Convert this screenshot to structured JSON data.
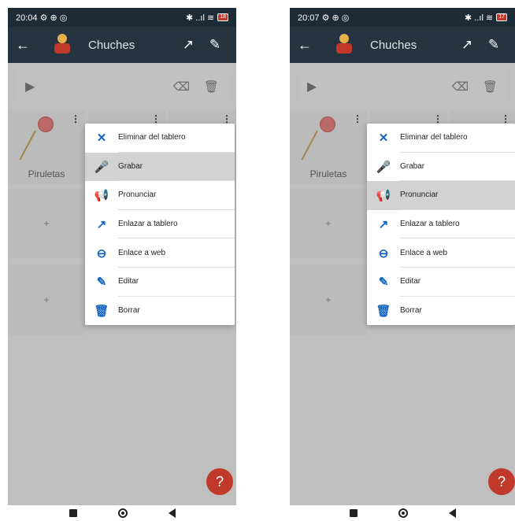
{
  "left": {
    "status": {
      "time": "20:04",
      "icons": "⚙ ⊕ ◎",
      "right_icons": "✱ ..ıl ≋",
      "battery": "18"
    },
    "appbar": {
      "title": "Chuches",
      "back": "←",
      "open": "↗",
      "edit": "✎"
    },
    "tiles": [
      {
        "label": "Piruletas"
      },
      {
        "plus": "+"
      },
      {
        "plus": "+"
      }
    ],
    "menu": {
      "selected": 1,
      "items": [
        {
          "label": "Eliminar del tablero",
          "icon": "✕"
        },
        {
          "label": "Grabar",
          "icon": "🎤"
        },
        {
          "label": "Pronunciar",
          "icon": "📢"
        },
        {
          "label": "Enlazar a tablero",
          "icon": "↗"
        },
        {
          "label": "Enlace a web",
          "icon": "⊖"
        },
        {
          "label": "Editar",
          "icon": "✎"
        },
        {
          "label": "Borrar",
          "icon": "🗑"
        }
      ]
    },
    "help": "?"
  },
  "right": {
    "status": {
      "time": "20:07",
      "icons": "⚙ ⊕ ◎",
      "right_icons": "✱ ..ıl ≋",
      "battery": "17"
    },
    "appbar": {
      "title": "Chuches",
      "back": "←",
      "open": "↗",
      "edit": "✎"
    },
    "tiles": [
      {
        "label": "Piruletas"
      },
      {
        "plus": "+"
      },
      {
        "plus": "+"
      }
    ],
    "menu": {
      "selected": 2,
      "items": [
        {
          "label": "Eliminar del tablero",
          "icon": "✕"
        },
        {
          "label": "Grabar",
          "icon": "🎤"
        },
        {
          "label": "Pronunciar",
          "icon": "📢"
        },
        {
          "label": "Enlazar a tablero",
          "icon": "↗"
        },
        {
          "label": "Enlace a web",
          "icon": "⊖"
        },
        {
          "label": "Editar",
          "icon": "✎"
        },
        {
          "label": "Borrar",
          "icon": "🗑"
        }
      ]
    },
    "help": "?"
  },
  "colors": {
    "appbar": "#263340",
    "accent": "#1565c0",
    "help": "#c0392b",
    "selected": "#d2d2d2"
  },
  "icons": {
    "play": "play-icon",
    "backspace": "backspace-icon",
    "trash": "trash-icon"
  }
}
